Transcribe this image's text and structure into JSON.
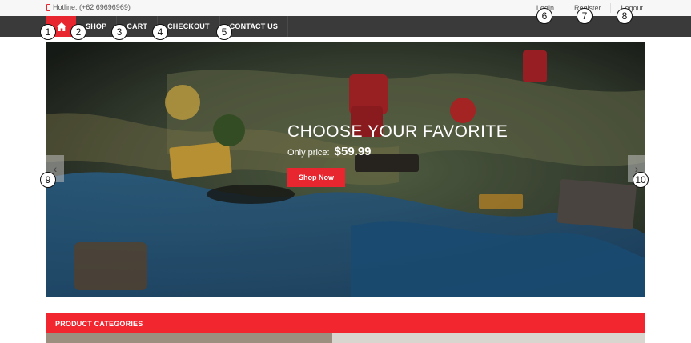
{
  "topbar": {
    "hotline": "Hotline: (+62 69696969)",
    "login": "Login",
    "register": "Register",
    "logout": "Logout"
  },
  "nav": {
    "items": [
      "SHOP",
      "CART",
      "CHECKOUT",
      "CONTACT US"
    ]
  },
  "slider": {
    "title": "CHOOSE YOUR FAVORITE",
    "price_label": "Only price:",
    "price_value": "$59.99",
    "button": "Shop Now",
    "prev_arrow": "‹",
    "next_arrow": "›"
  },
  "categories": {
    "header": "PRODUCT CATEGORIES"
  },
  "markers": [
    "1",
    "2",
    "3",
    "4",
    "5",
    "6",
    "7",
    "8",
    "9",
    "10"
  ],
  "colors": {
    "accent": "#e8262f",
    "navbar": "#3a3a3a",
    "topbar": "#f7f7f7"
  }
}
